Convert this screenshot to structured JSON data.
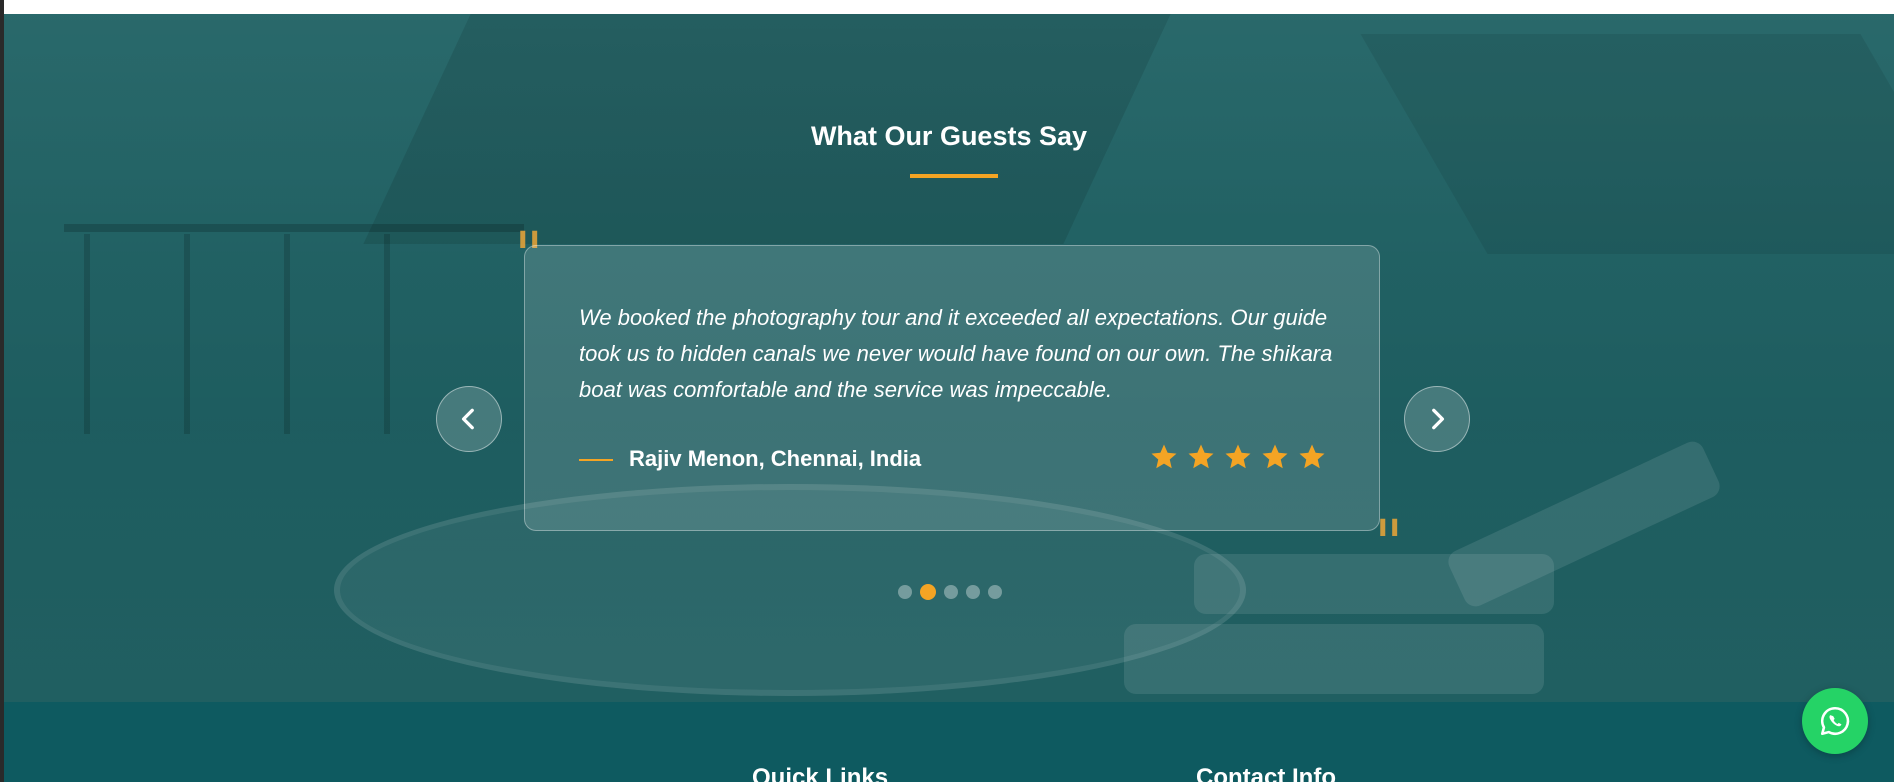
{
  "testimonials": {
    "title": "What Our Guests Say",
    "current": {
      "quote": "We booked the photography tour and it exceeded all expectations. Our guide took us to hidden canals we never would have found on our own. The shikara boat was comfortable and the service was impeccable.",
      "author": "Rajiv Menon, Chennai, India",
      "rating": 5,
      "max_rating": 5
    },
    "slide_count": 5,
    "active_slide": 2
  },
  "footer": {
    "quick_links_heading": "Quick Links",
    "contact_heading": "Contact Info"
  },
  "colors": {
    "accent": "#f4a424",
    "overlay_teal": "#186064",
    "footer_bg": "#0e5a60",
    "whatsapp_green": "#25d366"
  },
  "icons": {
    "prev": "chevron-left-icon",
    "next": "chevron-right-icon",
    "rating": "star-icon",
    "chat": "whatsapp-icon"
  }
}
